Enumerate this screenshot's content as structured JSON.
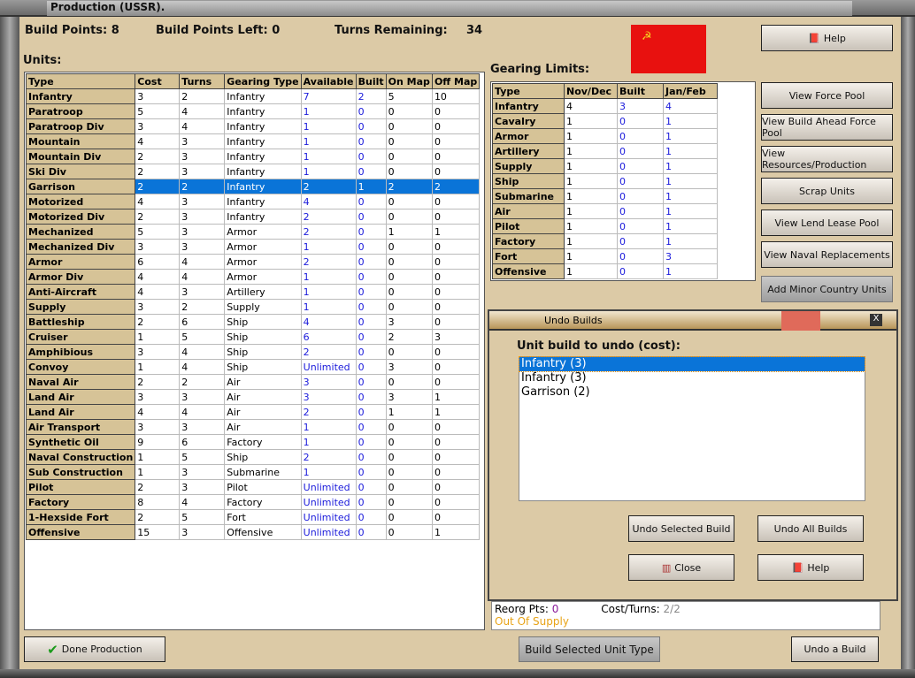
{
  "window": {
    "title": "Production (USSR)."
  },
  "header": {
    "build_points": "Build Points: 8",
    "build_points_left": "Build Points Left:  0",
    "turns_remaining_label": "Turns Remaining:",
    "turns_remaining": "34"
  },
  "units": {
    "label": "Units:",
    "columns": [
      "Type",
      "Cost",
      "Turns",
      "Gearing Type",
      "Available",
      "Built",
      "On Map",
      "Off Map"
    ],
    "selected_index": 6,
    "rows": [
      [
        "Infantry",
        "3",
        "2",
        "Infantry",
        "7",
        "2",
        "5",
        "10"
      ],
      [
        "Paratroop",
        "5",
        "4",
        "Infantry",
        "1",
        "0",
        "0",
        "0"
      ],
      [
        "Paratroop Div",
        "3",
        "4",
        "Infantry",
        "1",
        "0",
        "0",
        "0"
      ],
      [
        "Mountain",
        "4",
        "3",
        "Infantry",
        "1",
        "0",
        "0",
        "0"
      ],
      [
        "Mountain Div",
        "2",
        "3",
        "Infantry",
        "1",
        "0",
        "0",
        "0"
      ],
      [
        "Ski Div",
        "2",
        "3",
        "Infantry",
        "1",
        "0",
        "0",
        "0"
      ],
      [
        "Garrison",
        "2",
        "2",
        "Infantry",
        "2",
        "1",
        "2",
        "2"
      ],
      [
        "Motorized",
        "4",
        "3",
        "Infantry",
        "4",
        "0",
        "0",
        "0"
      ],
      [
        "Motorized Div",
        "2",
        "3",
        "Infantry",
        "2",
        "0",
        "0",
        "0"
      ],
      [
        "Mechanized",
        "5",
        "3",
        "Armor",
        "2",
        "0",
        "1",
        "1"
      ],
      [
        "Mechanized Div",
        "3",
        "3",
        "Armor",
        "1",
        "0",
        "0",
        "0"
      ],
      [
        "Armor",
        "6",
        "4",
        "Armor",
        "2",
        "0",
        "0",
        "0"
      ],
      [
        "Armor Div",
        "4",
        "4",
        "Armor",
        "1",
        "0",
        "0",
        "0"
      ],
      [
        "Anti-Aircraft",
        "4",
        "3",
        "Artillery",
        "1",
        "0",
        "0",
        "0"
      ],
      [
        "Supply",
        "3",
        "2",
        "Supply",
        "1",
        "0",
        "0",
        "0"
      ],
      [
        "Battleship",
        "2",
        "6",
        "Ship",
        "4",
        "0",
        "3",
        "0"
      ],
      [
        "Cruiser",
        "1",
        "5",
        "Ship",
        "6",
        "0",
        "2",
        "3"
      ],
      [
        "Amphibious",
        "3",
        "4",
        "Ship",
        "2",
        "0",
        "0",
        "0"
      ],
      [
        "Convoy",
        "1",
        "4",
        "Ship",
        "Unlimited",
        "0",
        "3",
        "0"
      ],
      [
        "Naval Air",
        "2",
        "2",
        "Air",
        "3",
        "0",
        "0",
        "0"
      ],
      [
        "Land Air",
        "3",
        "3",
        "Air",
        "3",
        "0",
        "3",
        "1"
      ],
      [
        "Land Air",
        "4",
        "4",
        "Air",
        "2",
        "0",
        "1",
        "1"
      ],
      [
        "Air Transport",
        "3",
        "3",
        "Air",
        "1",
        "0",
        "0",
        "0"
      ],
      [
        "Synthetic Oil",
        "9",
        "6",
        "Factory",
        "1",
        "0",
        "0",
        "0"
      ],
      [
        "Naval Construction",
        "1",
        "5",
        "Ship",
        "2",
        "0",
        "0",
        "0"
      ],
      [
        "Sub Construction",
        "1",
        "3",
        "Submarine",
        "1",
        "0",
        "0",
        "0"
      ],
      [
        "Pilot",
        "2",
        "3",
        "Pilot",
        "Unlimited",
        "0",
        "0",
        "0"
      ],
      [
        "Factory",
        "8",
        "4",
        "Factory",
        "Unlimited",
        "0",
        "0",
        "0"
      ],
      [
        "1-Hexside Fort",
        "2",
        "5",
        "Fort",
        "Unlimited",
        "0",
        "0",
        "0"
      ],
      [
        "Offensive",
        "15",
        "3",
        "Offensive",
        "Unlimited",
        "0",
        "0",
        "1"
      ]
    ]
  },
  "gearing": {
    "label": "Gearing Limits:",
    "columns": [
      "Type",
      "Nov/Dec",
      "Built",
      "Jan/Feb"
    ],
    "rows": [
      [
        "Infantry",
        "4",
        "3",
        "4"
      ],
      [
        "Cavalry",
        "1",
        "0",
        "1"
      ],
      [
        "Armor",
        "1",
        "0",
        "1"
      ],
      [
        "Artillery",
        "1",
        "0",
        "1"
      ],
      [
        "Supply",
        "1",
        "0",
        "1"
      ],
      [
        "Ship",
        "1",
        "0",
        "1"
      ],
      [
        "Submarine",
        "1",
        "0",
        "1"
      ],
      [
        "Air",
        "1",
        "0",
        "1"
      ],
      [
        "Pilot",
        "1",
        "0",
        "1"
      ],
      [
        "Factory",
        "1",
        "0",
        "1"
      ],
      [
        "Fort",
        "1",
        "0",
        "3"
      ],
      [
        "Offensive",
        "1",
        "0",
        "1"
      ]
    ]
  },
  "buttons": {
    "help": "Help",
    "view_force_pool": "View Force Pool",
    "view_build_ahead": "View Build Ahead Force Pool",
    "view_resources": "View Resources/Production",
    "scrap_units": "Scrap Units",
    "view_lend_lease": "View Lend Lease Pool",
    "view_naval": "View Naval Replacements",
    "add_minor": "Add Minor Country Units",
    "done_production": "Done Production",
    "build_selected": "Build Selected Unit Type",
    "undo_a_build": "Undo a Build"
  },
  "undo_dialog": {
    "title": "Undo Builds",
    "label": "Unit build to undo (cost):",
    "items": [
      "Infantry (3)",
      "Infantry (3)",
      "Garrison (2)"
    ],
    "undo_selected": "Undo Selected Build",
    "undo_all": "Undo All Builds",
    "close": "Close",
    "help": "Help"
  },
  "status": {
    "reorg_label": "Reorg Pts:",
    "reorg_value": "0",
    "cost_turns_label": "Cost/Turns:",
    "cost_turns_value": "2/2",
    "supply": "Out Of Supply"
  },
  "colors": {
    "selection": "#0a74d8",
    "flag": "#e8110f",
    "supply": "#e8a317"
  }
}
